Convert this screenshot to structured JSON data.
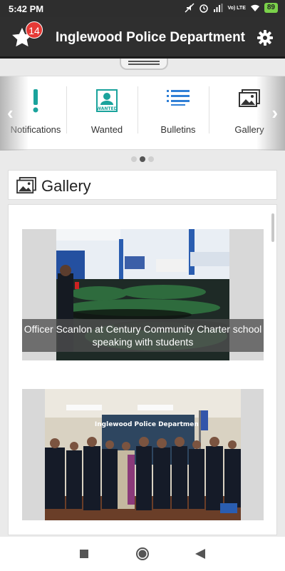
{
  "status_bar": {
    "time": "5:42 PM",
    "network": "Vo) LTE",
    "battery": "89"
  },
  "app_bar": {
    "title": "Inglewood Police Department",
    "badge_count": "14"
  },
  "carousel": {
    "items": [
      {
        "label": "Notifications",
        "icon": "exclamation-icon"
      },
      {
        "label": "Wanted",
        "icon": "wanted-poster-icon",
        "icon_text": "WANTED"
      },
      {
        "label": "Bulletins",
        "icon": "list-icon"
      },
      {
        "label": "Gallery",
        "icon": "gallery-icon"
      }
    ],
    "page_dots": 3,
    "active_dot": 1
  },
  "gallery": {
    "title": "Gallery",
    "items": [
      {
        "caption": "Officer Scanlon at Century Community Charter school speaking with students"
      },
      {
        "caption": "",
        "banner_text": "Inglewood Police Department"
      }
    ]
  },
  "colors": {
    "app_bar": "#2f2f2f",
    "accent_teal": "#1aa39c",
    "badge_red": "#e53935",
    "bulletins_blue": "#2f7fd6"
  }
}
